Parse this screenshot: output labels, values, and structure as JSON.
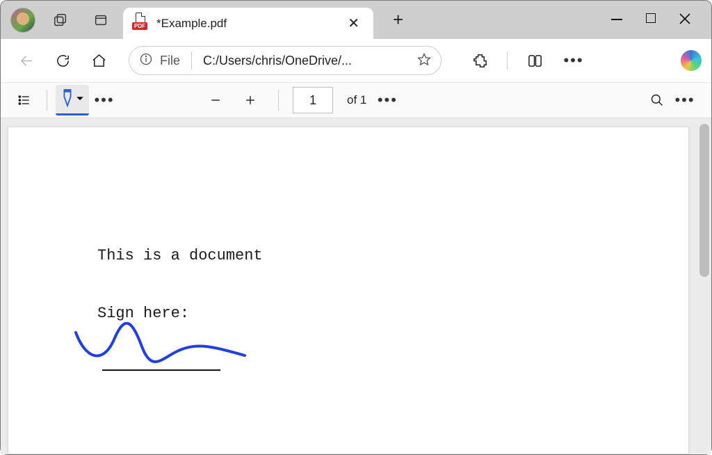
{
  "tab": {
    "badge": "PDF",
    "title": "*Example.pdf"
  },
  "addressbar": {
    "scheme_label": "File",
    "path": "C:/Users/chris/OneDrive/..."
  },
  "pdfbar": {
    "page_current": "1",
    "page_total_label": "of 1"
  },
  "document": {
    "line1": "This is a document",
    "line2": "Sign here:"
  }
}
